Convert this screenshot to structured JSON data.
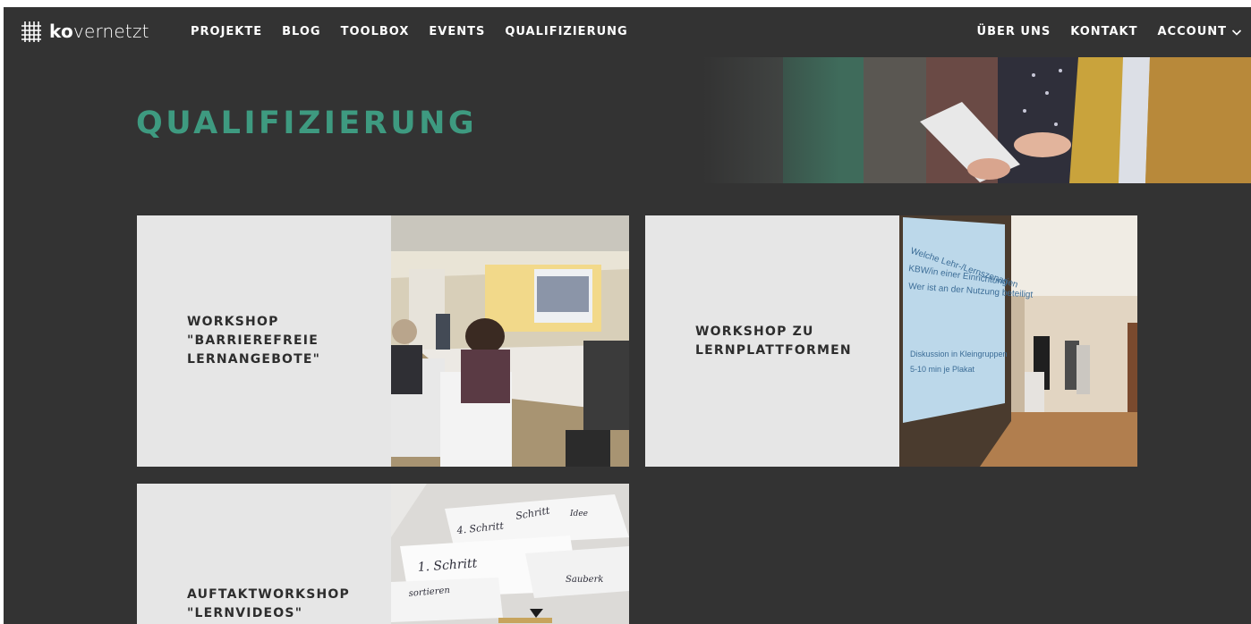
{
  "brand": {
    "logo_bold": "ko",
    "logo_light": "vernetzt"
  },
  "nav": {
    "left": [
      "PROJEKTE",
      "BLOG",
      "TOOLBOX",
      "EVENTS",
      "QUALIFIZIERUNG"
    ],
    "right": [
      "ÜBER UNS",
      "KONTAKT",
      "ACCOUNT"
    ]
  },
  "page": {
    "title": "QUALIFIZIERUNG"
  },
  "cards": [
    {
      "label": "WORKSHOP\n\"BARRIEREFREIE\nLERNANGEBOTE\""
    },
    {
      "label": "WORKSHOP ZU\nLERNPLATTFORMEN"
    },
    {
      "label": "AUFTAKTWORKSHOP\n\"LERNVIDEOS\""
    }
  ],
  "photo_texts": {
    "slide": [
      "Welche Lehr-/Lernszenarien",
      "KBW/in einer Einrichtung",
      "Wer ist an der Nutzung beteiligt",
      "Diskussion in Kleingruppen",
      "5-10 min je Plakat"
    ],
    "notes": [
      "1. Schritt",
      "4. Schritt",
      "Schritt",
      "Sauberk",
      "sortieren",
      "Idee"
    ]
  },
  "colors": {
    "background": "#333333",
    "accent": "#3e9a80",
    "card_bg": "#e6e6e6",
    "nav_text": "#ffffff"
  },
  "icons": [
    "logo-grid-icon",
    "chevron-down-icon"
  ]
}
